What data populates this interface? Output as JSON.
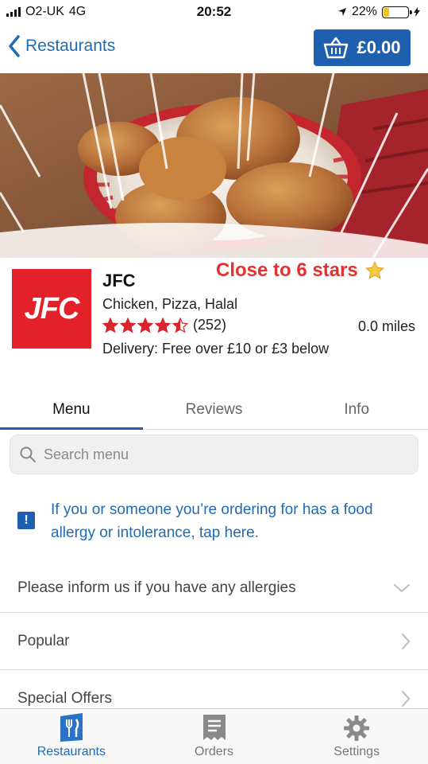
{
  "status_bar": {
    "carrier": "O2-UK",
    "network": "4G",
    "time": "20:52",
    "battery": "22%",
    "battery_level": 0.22
  },
  "nav": {
    "back_label": "Restaurants",
    "basket_total": "£0.00"
  },
  "restaurant": {
    "logo_text": "JFC",
    "name": "JFC",
    "promo": "Close to 6 stars",
    "cuisines": "Chicken, Pizza, Halal",
    "rating": 4.5,
    "review_count": "(252)",
    "distance": "0.0 miles",
    "delivery": "Delivery: Free over £10 or £3 below"
  },
  "tabs": [
    {
      "label": "Menu",
      "active": true
    },
    {
      "label": "Reviews",
      "active": false
    },
    {
      "label": "Info",
      "active": false
    }
  ],
  "search": {
    "placeholder": "Search menu"
  },
  "allergy": {
    "message": "If you or someone you’re ordering for has a food allergy or intolerance, tap here."
  },
  "menu_sections": [
    {
      "label": "Please inform us if you have any allergies",
      "icon": "chevron-down-icon"
    },
    {
      "label": "Popular",
      "icon": "chevron-right-icon"
    },
    {
      "label": "Special Offers",
      "icon": "chevron-right-icon"
    }
  ],
  "tab_bar": [
    {
      "label": "Restaurants",
      "icon": "restaurant-icon",
      "active": true
    },
    {
      "label": "Orders",
      "icon": "receipt-icon",
      "active": false
    },
    {
      "label": "Settings",
      "icon": "gear-icon",
      "active": false
    }
  ],
  "colors": {
    "brand_blue": "#1f5fb0",
    "link_blue": "#1f6bb5",
    "logo_red": "#e3212b",
    "star_red": "#d9252c",
    "promo_red": "#e3312f"
  }
}
